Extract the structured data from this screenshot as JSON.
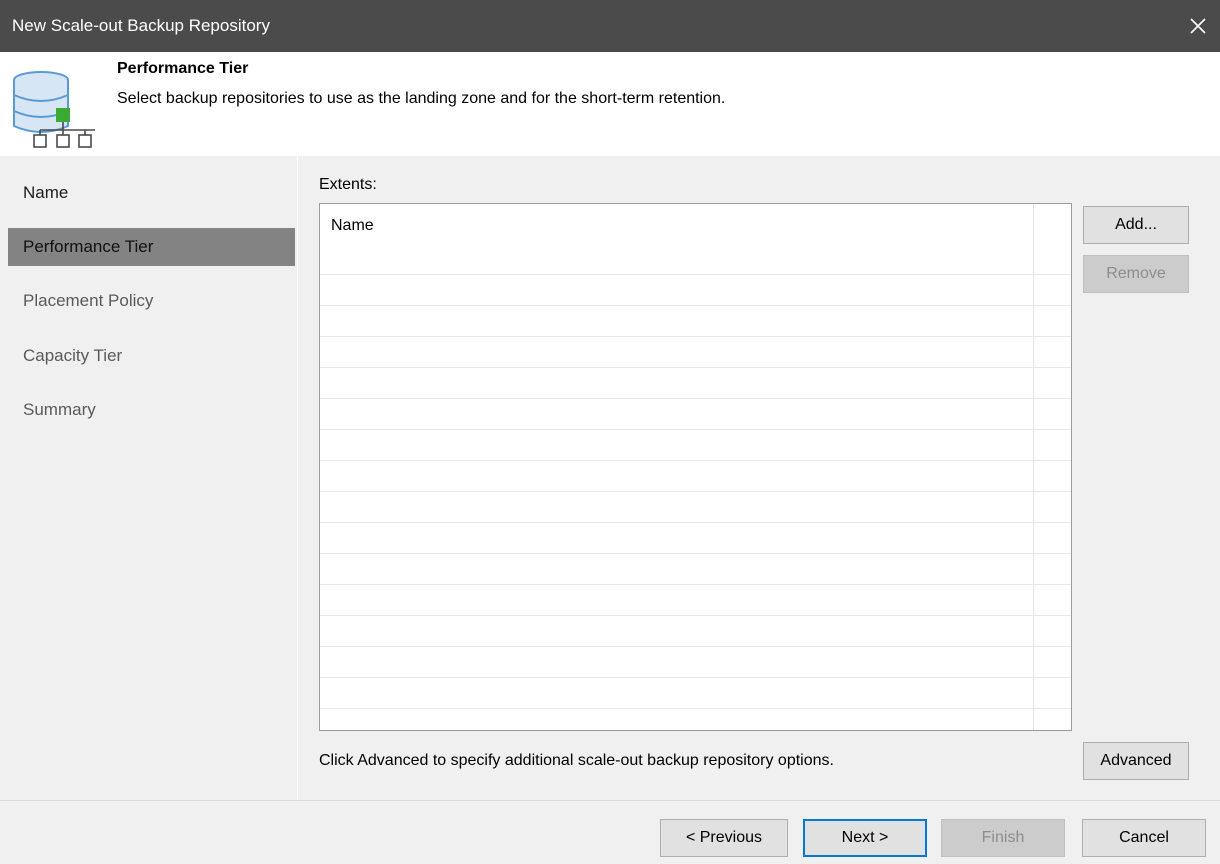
{
  "window": {
    "title": "New Scale-out Backup Repository",
    "close_icon": "close-icon"
  },
  "header": {
    "icon": "repository-database-icon",
    "title": "Performance Tier",
    "description": "Select backup repositories to use as the landing zone and for the short-term retention."
  },
  "sidebar": {
    "items": [
      {
        "label": "Name",
        "state": "completed"
      },
      {
        "label": "Performance Tier",
        "state": "active"
      },
      {
        "label": "Placement Policy",
        "state": "pending"
      },
      {
        "label": "Capacity Tier",
        "state": "pending"
      },
      {
        "label": "Summary",
        "state": "pending"
      }
    ]
  },
  "main": {
    "extents_label": "Extents:",
    "columns": [
      "Name"
    ],
    "rows": [],
    "add_label": "Add...",
    "remove_label": "Remove",
    "hint": "Click Advanced to specify additional scale-out backup repository options.",
    "advanced_label": "Advanced"
  },
  "footer": {
    "previous_label": "< Previous",
    "next_label": "Next >",
    "finish_label": "Finish",
    "cancel_label": "Cancel"
  },
  "colors": {
    "titlebar": "#4b4b4b",
    "panel": "#f0f0f0",
    "active_step": "#838383",
    "default_button_border": "#0078d7",
    "icon_green": "#3aaa35",
    "icon_blue": "#5b9bd5"
  }
}
